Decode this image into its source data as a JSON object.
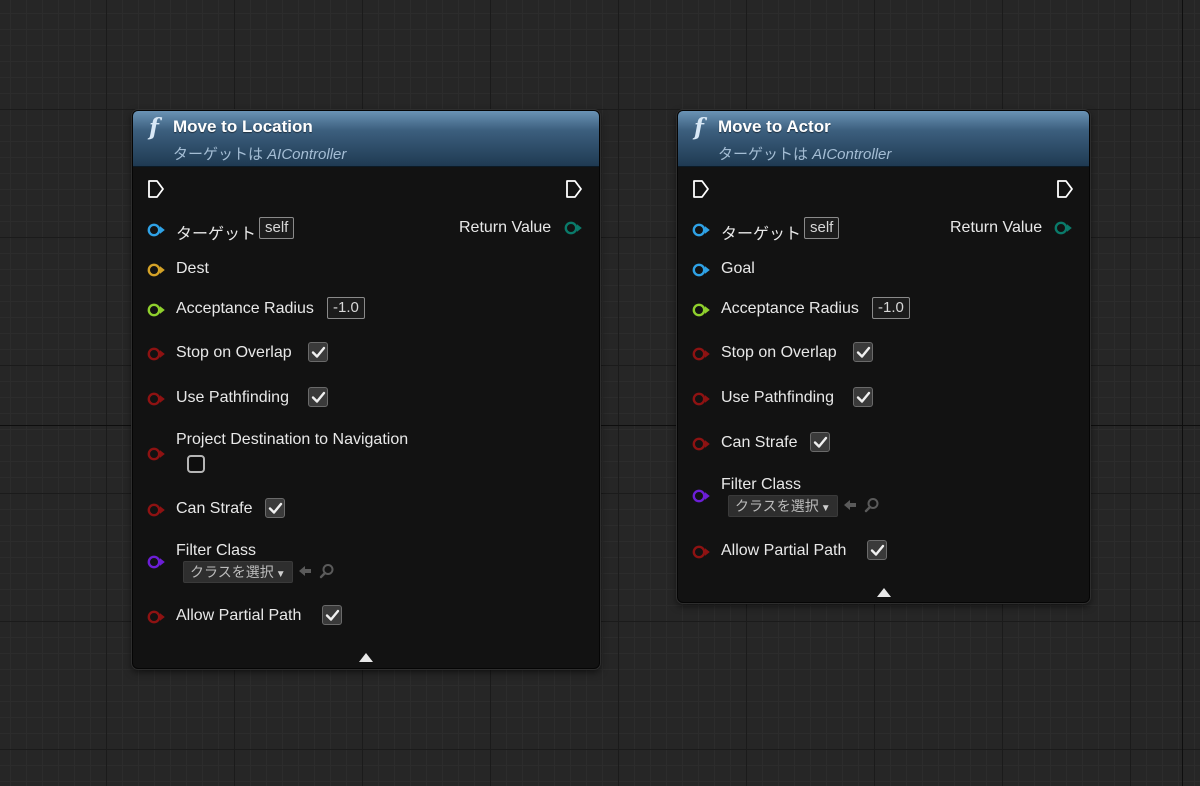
{
  "colors": {
    "object_pin": "#2fa2e6",
    "vector_pin": "#d4a227",
    "float_pin": "#8fd02d",
    "bool_pin": "#8e1212",
    "class_pin": "#6c1ed6",
    "return_pin": "#0a7a6a",
    "header_start": "#6a93b5",
    "header_end": "#1f3a52"
  },
  "nodes": [
    {
      "icon": "function-icon",
      "icon_glyph": "f",
      "title": "Move to Location",
      "subtitle_prefix": "ターゲットは ",
      "subtitle_target": "AIController",
      "return_label": "Return Value",
      "target_label": "ターゲット",
      "target_value": "self",
      "dest_label": "Dest",
      "acceptance_label": "Acceptance Radius",
      "acceptance_value": "-1.0",
      "stop_overlap_label": "Stop on Overlap",
      "stop_overlap_checked": true,
      "use_pathfinding_label": "Use Pathfinding",
      "use_pathfinding_checked": true,
      "project_dest_label": "Project Destination to Navigation",
      "project_dest_checked": false,
      "can_strafe_label": "Can Strafe",
      "can_strafe_checked": true,
      "filter_class_label": "Filter Class",
      "filter_class_dropdown": "クラスを選択",
      "allow_partial_label": "Allow Partial Path",
      "allow_partial_checked": true
    },
    {
      "icon": "function-icon",
      "icon_glyph": "f",
      "title": "Move to Actor",
      "subtitle_prefix": "ターゲットは ",
      "subtitle_target": "AIController",
      "return_label": "Return Value",
      "target_label": "ターゲット",
      "target_value": "self",
      "goal_label": "Goal",
      "acceptance_label": "Acceptance Radius",
      "acceptance_value": "-1.0",
      "stop_overlap_label": "Stop on Overlap",
      "stop_overlap_checked": true,
      "use_pathfinding_label": "Use Pathfinding",
      "use_pathfinding_checked": true,
      "can_strafe_label": "Can Strafe",
      "can_strafe_checked": true,
      "filter_class_label": "Filter Class",
      "filter_class_dropdown": "クラスを選択",
      "allow_partial_label": "Allow Partial Path",
      "allow_partial_checked": true
    }
  ]
}
